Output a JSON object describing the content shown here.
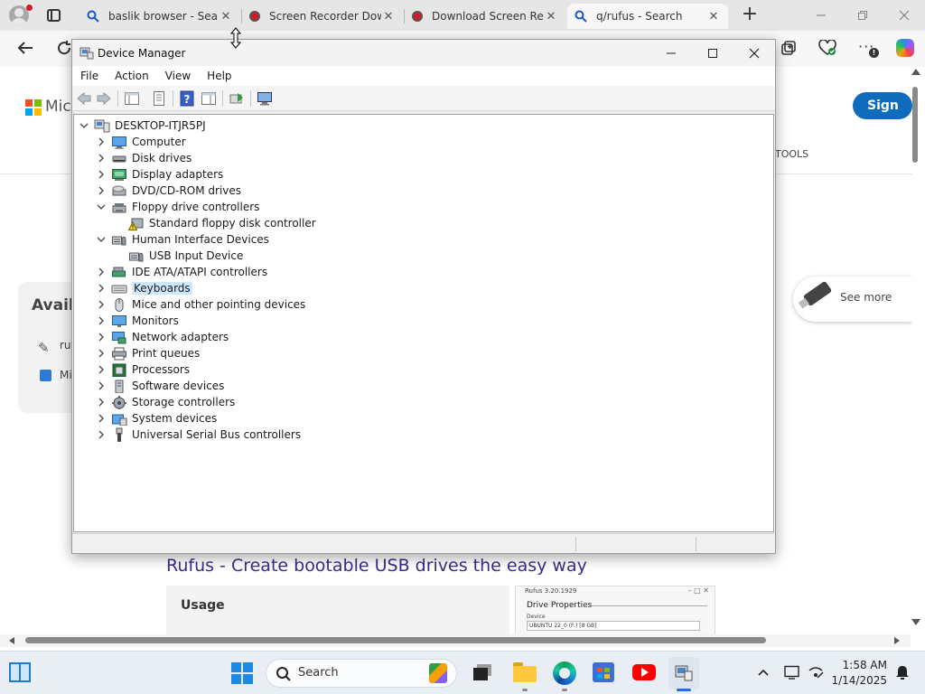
{
  "browser": {
    "tabs": [
      {
        "label": "baslik browser - Search",
        "icon": "search-icon"
      },
      {
        "label": "Screen Recorder Download",
        "icon": "record-icon"
      },
      {
        "label": "Download Screen Recorder",
        "icon": "record-icon"
      },
      {
        "label": "q/rufus - Search",
        "icon": "search-icon",
        "active": true
      }
    ],
    "new_tab_label": "+",
    "page": {
      "sign_in": "Sign in",
      "tools_label": "TOOLS",
      "brand_fragment": "Micr",
      "avail_fragment": "Availa",
      "rufus_fragment": "ruf",
      "mi_fragment": "Mi",
      "see_more": "See more",
      "result_title": "Rufus - Create bootable USB drives the easy way",
      "usage_label": "Usage",
      "rufus_thumb": {
        "title": "Rufus 3.20.1929",
        "heading": "Drive Properties",
        "device_label": "Device",
        "device_value": "UBUNTU 22_0 (F:) [8 GB]"
      }
    }
  },
  "device_manager": {
    "title": "Device Manager",
    "menu": [
      "File",
      "Action",
      "View",
      "Help"
    ],
    "root": "DESKTOP-ITJR5PJ",
    "items": [
      {
        "label": "Computer",
        "expanded": false,
        "icon": "computer-icon"
      },
      {
        "label": "Disk drives",
        "expanded": false,
        "icon": "disk-drive-icon"
      },
      {
        "label": "Display adapters",
        "expanded": false,
        "icon": "display-adapter-icon"
      },
      {
        "label": "DVD/CD-ROM drives",
        "expanded": false,
        "icon": "dvd-drive-icon"
      },
      {
        "label": "Floppy drive controllers",
        "expanded": true,
        "icon": "floppy-controller-icon",
        "children": [
          {
            "label": "Standard floppy disk controller",
            "icon": "warning-device-icon"
          }
        ]
      },
      {
        "label": "Human Interface Devices",
        "expanded": true,
        "icon": "hid-icon",
        "children": [
          {
            "label": "USB Input Device",
            "icon": "hid-icon"
          }
        ]
      },
      {
        "label": "IDE ATA/ATAPI controllers",
        "expanded": false,
        "icon": "ide-controller-icon"
      },
      {
        "label": "Keyboards",
        "expanded": false,
        "icon": "keyboard-icon",
        "selected": true
      },
      {
        "label": "Mice and other pointing devices",
        "expanded": false,
        "icon": "mouse-icon"
      },
      {
        "label": "Monitors",
        "expanded": false,
        "icon": "monitor-icon"
      },
      {
        "label": "Network adapters",
        "expanded": false,
        "icon": "network-adapter-icon"
      },
      {
        "label": "Print queues",
        "expanded": false,
        "icon": "printer-icon"
      },
      {
        "label": "Processors",
        "expanded": false,
        "icon": "processor-icon"
      },
      {
        "label": "Software devices",
        "expanded": false,
        "icon": "software-device-icon"
      },
      {
        "label": "Storage controllers",
        "expanded": false,
        "icon": "storage-controller-icon"
      },
      {
        "label": "System devices",
        "expanded": false,
        "icon": "system-device-icon"
      },
      {
        "label": "Universal Serial Bus controllers",
        "expanded": false,
        "icon": "usb-icon"
      }
    ]
  },
  "taskbar": {
    "search_placeholder": "Search",
    "time": "1:58 AM",
    "date": "1/14/2025"
  }
}
